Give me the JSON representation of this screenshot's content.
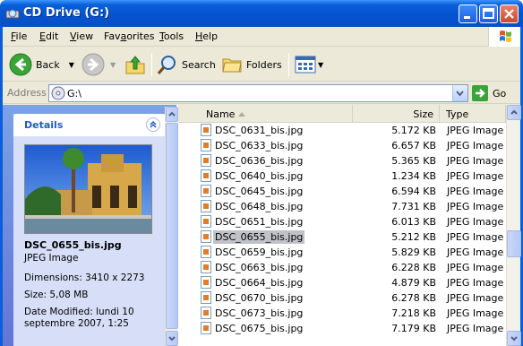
{
  "window": {
    "title": "CD Drive (G:)"
  },
  "menu": [
    "File",
    "Edit",
    "View",
    "Favorites",
    "Tools",
    "Help"
  ],
  "menu_access": [
    "F",
    "E",
    "V",
    "a",
    "T",
    "H"
  ],
  "toolbar": {
    "back_label": "Back",
    "search_label": "Search",
    "folders_label": "Folders"
  },
  "address": {
    "label": "Address",
    "value": "G:\\",
    "go_label": "Go"
  },
  "details": {
    "title": "Details",
    "file_name": "DSC_0655_bis.jpg",
    "file_type": "JPEG Image",
    "dimensions": "Dimensions: 3410 x 2273",
    "size": "Size: 5,08 MB",
    "date_modified": "Date Modified: lundi 10 septembre 2007, 1:25"
  },
  "columns": {
    "name": "Name",
    "size": "Size",
    "type": "Type"
  },
  "files": [
    {
      "name": "DSC_0631_bis.jpg",
      "size": "5.172 KB",
      "type": "JPEG Image"
    },
    {
      "name": "DSC_0633_bis.jpg",
      "size": "6.657 KB",
      "type": "JPEG Image"
    },
    {
      "name": "DSC_0636_bis.jpg",
      "size": "5.365 KB",
      "type": "JPEG Image"
    },
    {
      "name": "DSC_0640_bis.jpg",
      "size": "1.234 KB",
      "type": "JPEG Image"
    },
    {
      "name": "DSC_0645_bis.jpg",
      "size": "6.594 KB",
      "type": "JPEG Image"
    },
    {
      "name": "DSC_0648_bis.jpg",
      "size": "7.731 KB",
      "type": "JPEG Image"
    },
    {
      "name": "DSC_0651_bis.jpg",
      "size": "6.013 KB",
      "type": "JPEG Image"
    },
    {
      "name": "DSC_0655_bis.jpg",
      "size": "5.212 KB",
      "type": "JPEG Image",
      "selected": true
    },
    {
      "name": "DSC_0659_bis.jpg",
      "size": "5.829 KB",
      "type": "JPEG Image"
    },
    {
      "name": "DSC_0663_bis.jpg",
      "size": "6.228 KB",
      "type": "JPEG Image"
    },
    {
      "name": "DSC_0664_bis.jpg",
      "size": "4.879 KB",
      "type": "JPEG Image"
    },
    {
      "name": "DSC_0670_bis.jpg",
      "size": "6.278 KB",
      "type": "JPEG Image"
    },
    {
      "name": "DSC_0673_bis.jpg",
      "size": "7.218 KB",
      "type": "JPEG Image"
    },
    {
      "name": "DSC_0675_bis.jpg",
      "size": "7.179 KB",
      "type": "JPEG Image"
    }
  ],
  "colors": {
    "titlebar": "#0a5fd8",
    "taskpane": "#6f8fe0",
    "selection": "#c1c2c9"
  }
}
